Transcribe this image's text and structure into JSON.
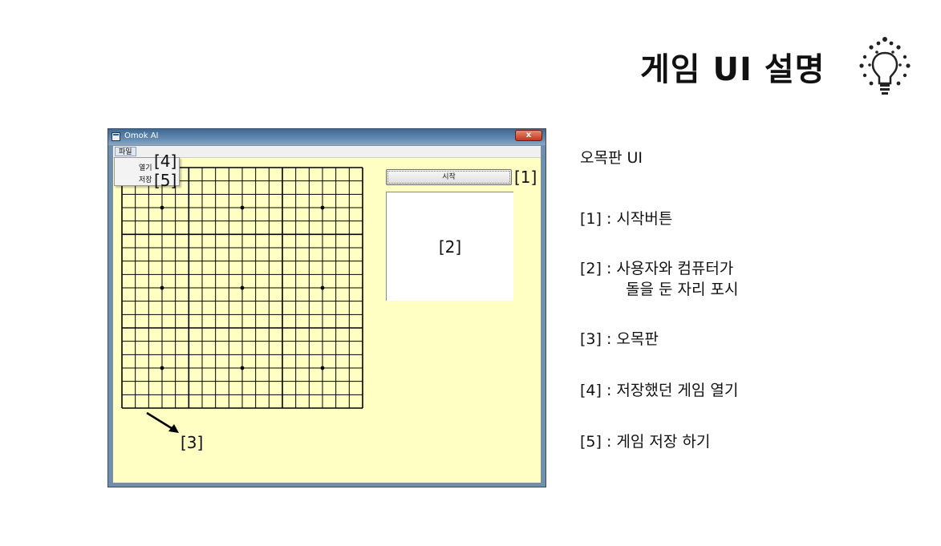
{
  "slide": {
    "title": "게임 UI 설명",
    "icon": "lightbulb-icon"
  },
  "window": {
    "title": "Omok AI",
    "close_label": "x",
    "menu": {
      "file_label": "파일",
      "items": [
        "열기",
        "저장"
      ]
    },
    "start_button_label": "시작",
    "board": {
      "size": 19,
      "star_points": 9,
      "line_color": "#000000",
      "background": "#ffffc4"
    }
  },
  "callouts": {
    "c1": "[1]",
    "c2": "[2]",
    "c3": "[3]",
    "c4": "[4]",
    "c5": "[5]"
  },
  "description": {
    "heading": "오목판 UI",
    "items": [
      {
        "line1": "[1] : 시작버튼"
      },
      {
        "line1": "[2] : 사용자와 컴퓨터가",
        "line2": "돌을 둔 자리 포시"
      },
      {
        "line1": "[3] : 오목판"
      },
      {
        "line1": "[4] : 저장했던 게임 열기"
      },
      {
        "line1": "[5] : 게임 저장 하기"
      }
    ]
  }
}
